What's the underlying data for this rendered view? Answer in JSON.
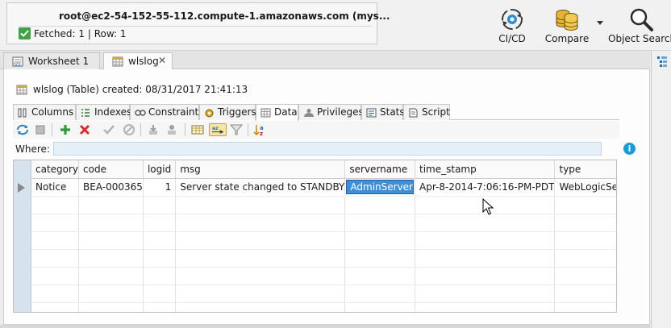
{
  "connection": {
    "host": "root@ec2-54-152-55-112.compute-1.amazonaws.com (mys...",
    "status": "Fetched: 1 | Row: 1"
  },
  "toolbar": {
    "cicd_label": "CI/CD",
    "compare_label": "Compare",
    "object_search_label": "Object Search"
  },
  "tabs": [
    {
      "label": "Worksheet 1",
      "icon": "sql-worksheet-icon"
    },
    {
      "label": "wlslog",
      "icon": "table-icon",
      "active": true
    }
  ],
  "object_title": "wlslog (Table) created: 08/31/2017 21:41:13",
  "subtabs": [
    {
      "label": "Columns",
      "icon": "columns-icon"
    },
    {
      "label": "Indexes",
      "icon": "indexes-icon"
    },
    {
      "label": "Constraints",
      "icon": "constraints-icon"
    },
    {
      "label": "Triggers",
      "icon": "triggers-icon"
    },
    {
      "label": "Data",
      "icon": "data-grid-icon",
      "active": true
    },
    {
      "label": "Privileges",
      "icon": "privileges-icon"
    },
    {
      "label": "Stats",
      "icon": "stats-icon"
    },
    {
      "label": "Script",
      "icon": "script-icon"
    }
  ],
  "where": {
    "label": "Where:",
    "value": ""
  },
  "grid": {
    "columns": [
      "category",
      "code",
      "logid",
      "msg",
      "servername",
      "time_stamp",
      "type"
    ],
    "rows": [
      [
        "Notice",
        "BEA-000365",
        "1",
        "Server state changed to STANDBY",
        "AdminServer",
        "Apr-8-2014-7:06:16-PM-PDT",
        "WebLogicServer"
      ]
    ],
    "selected_cell": {
      "row": 0,
      "column": "servername"
    }
  },
  "colors": {
    "accent": "#3e8fd8",
    "row_header": "#d6e3ee",
    "where_bg": "#e6f0f8",
    "status_ok": "#43a047"
  }
}
